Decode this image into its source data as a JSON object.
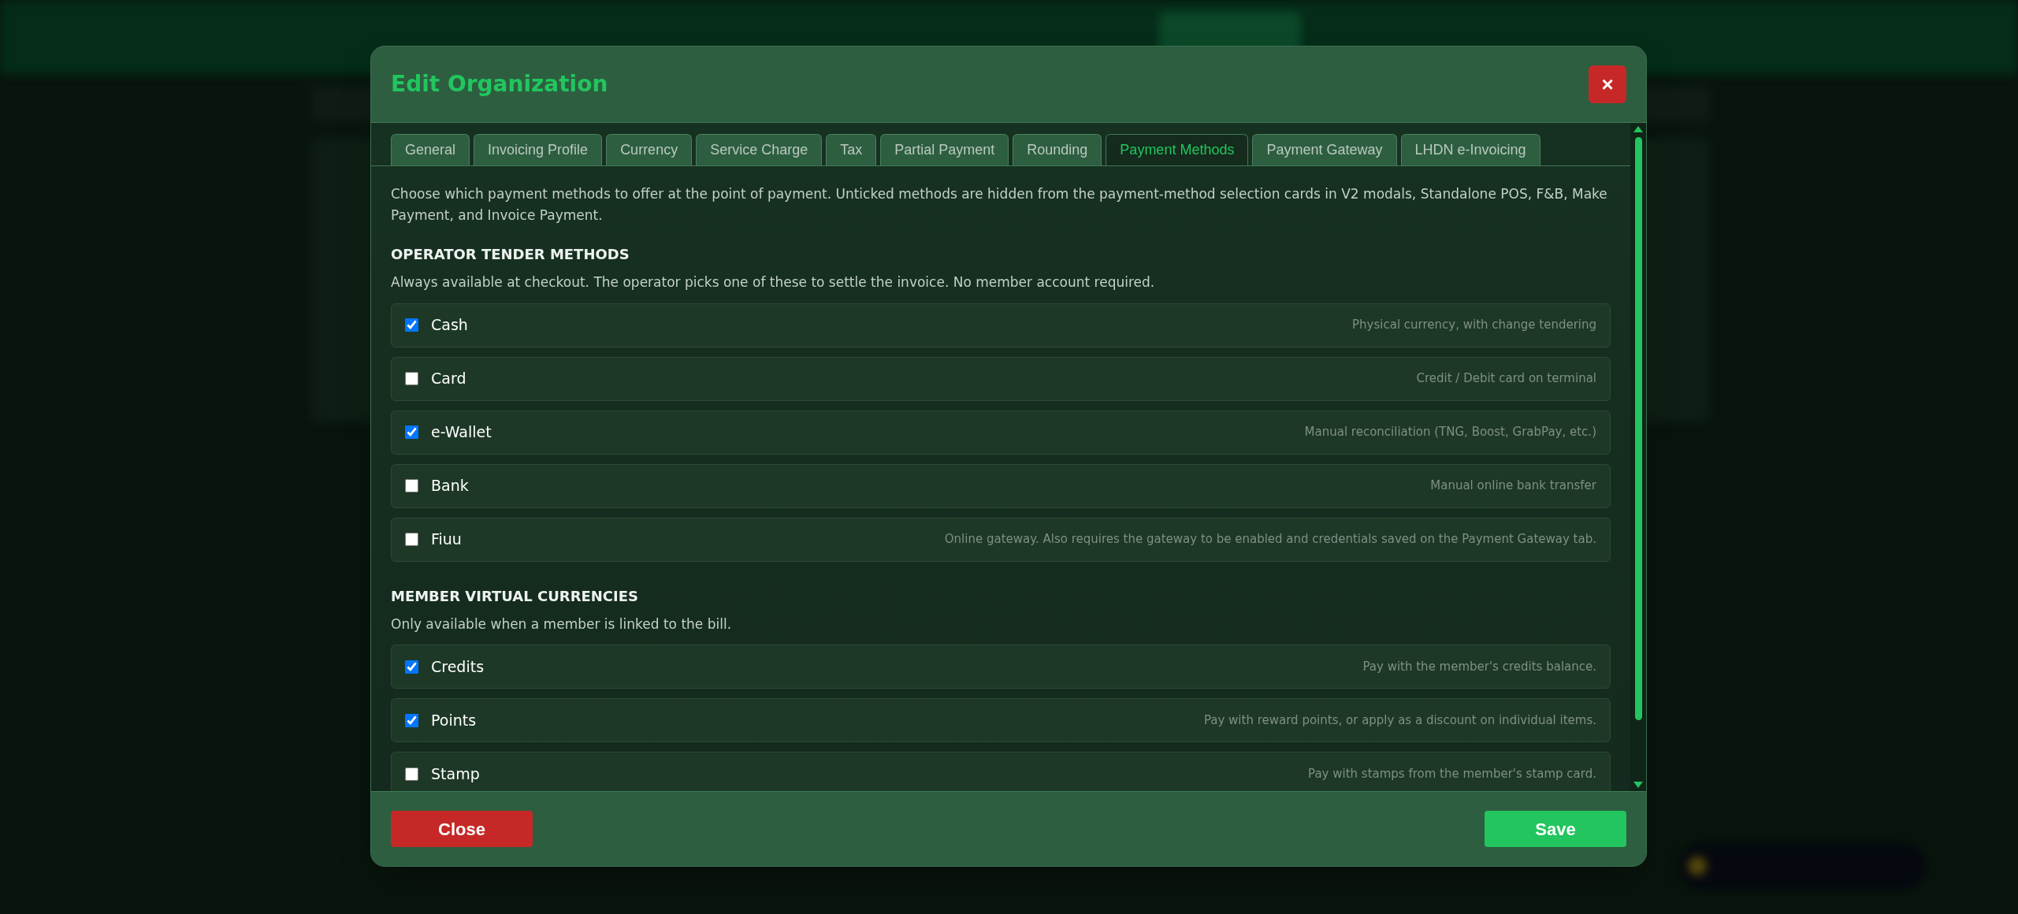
{
  "modal": {
    "title": "Edit Organization",
    "close_icon": "×"
  },
  "tabs": [
    {
      "label": "General",
      "selected": false
    },
    {
      "label": "Invoicing Profile",
      "selected": false
    },
    {
      "label": "Currency",
      "selected": false
    },
    {
      "label": "Service Charge",
      "selected": false
    },
    {
      "label": "Tax",
      "selected": false
    },
    {
      "label": "Partial Payment",
      "selected": false
    },
    {
      "label": "Rounding",
      "selected": false
    },
    {
      "label": "Payment Methods",
      "selected": true
    },
    {
      "label": "Payment Gateway",
      "selected": false
    },
    {
      "label": "LHDN e-Invoicing",
      "selected": false
    }
  ],
  "intro": "Choose which payment methods to offer at the point of payment. Unticked methods are hidden from the payment-method selection cards in V2 modals, Standalone POS, F&B, Make Payment, and Invoice Payment.",
  "sections": [
    {
      "heading": "OPERATOR TENDER METHODS",
      "description": "Always available at checkout. The operator picks one of these to settle the invoice. No member account required.",
      "methods": [
        {
          "name": "Cash",
          "checked": true,
          "hint": "Physical currency, with change tendering"
        },
        {
          "name": "Card",
          "checked": false,
          "hint": "Credit / Debit card on terminal"
        },
        {
          "name": "e-Wallet",
          "checked": true,
          "hint": "Manual reconciliation (TNG, Boost, GrabPay, etc.)"
        },
        {
          "name": "Bank",
          "checked": false,
          "hint": "Manual online bank transfer"
        },
        {
          "name": "Fiuu",
          "checked": false,
          "hint": "Online gateway. Also requires the gateway to be enabled and credentials saved on the Payment Gateway tab."
        }
      ]
    },
    {
      "heading": "MEMBER VIRTUAL CURRENCIES",
      "description": "Only available when a member is linked to the bill.",
      "methods": [
        {
          "name": "Credits",
          "checked": true,
          "hint": "Pay with the member's credits balance."
        },
        {
          "name": "Points",
          "checked": true,
          "hint": "Pay with reward points, or apply as a discount on individual items."
        },
        {
          "name": "Stamp",
          "checked": false,
          "hint": "Pay with stamps from the member's stamp card."
        }
      ]
    }
  ],
  "footer": {
    "close": "Close",
    "save": "Save"
  }
}
